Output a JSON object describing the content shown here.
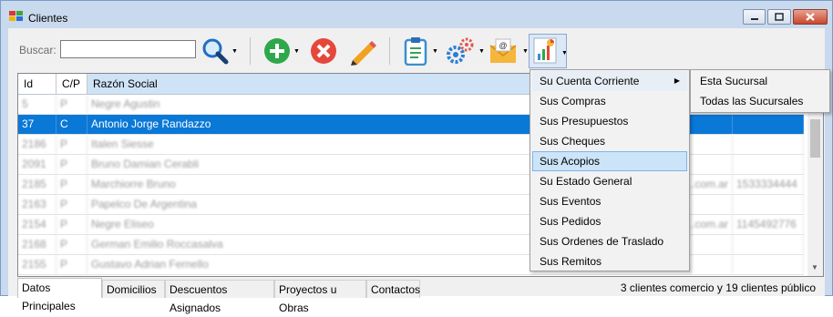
{
  "window": {
    "title": "Clientes"
  },
  "toolbar": {
    "search_label": "Buscar:",
    "search_value": "",
    "buttons": [
      "search-icon",
      "add-icon",
      "delete-icon",
      "edit-icon",
      "clipboard-icon",
      "gear-icon",
      "email-icon",
      "chart-icon"
    ]
  },
  "grid": {
    "headers": [
      "Id",
      "C/P",
      "Razón Social"
    ],
    "rows": [
      {
        "id": "5",
        "cp": "P",
        "rs": "Negre Agustin",
        "ex1": "",
        "ex2": ""
      },
      {
        "id": "37",
        "cp": "C",
        "rs": "Antonio Jorge Randazzo",
        "ex1": "",
        "ex2": ""
      },
      {
        "id": "2186",
        "cp": "P",
        "rs": "Italen Siesse",
        "ex1": "",
        "ex2": ""
      },
      {
        "id": "2091",
        "cp": "P",
        "rs": "Bruno Damian Cerabli",
        "ex1": "",
        "ex2": ""
      },
      {
        "id": "2185",
        "cp": "P",
        "rs": "Marchiorre Bruno",
        "ex1": "...com.ar",
        "ex2": "1533334444"
      },
      {
        "id": "2163",
        "cp": "P",
        "rs": "Papelco De Argentina",
        "ex1": "",
        "ex2": ""
      },
      {
        "id": "2154",
        "cp": "P",
        "rs": "Negre Eliseo",
        "ex1": "...com.ar",
        "ex2": "1145492776"
      },
      {
        "id": "2168",
        "cp": "P",
        "rs": "German Emilio Roccasalva",
        "ex1": "",
        "ex2": ""
      },
      {
        "id": "2155",
        "cp": "P",
        "rs": "Gustavo Adrian Fernello",
        "ex1": "",
        "ex2": ""
      }
    ]
  },
  "menu": {
    "items": [
      "Su Cuenta Corriente",
      "Sus Compras",
      "Sus Presupuestos",
      "Sus Cheques",
      "Sus Acopios",
      "Su Estado General",
      "Sus Eventos",
      "Sus Pedidos",
      "Sus Ordenes de Traslado",
      "Sus Remitos"
    ],
    "highlighted": "Sus Acopios"
  },
  "submenu": {
    "items": [
      "Esta Sucursal",
      "Todas las Sucursales"
    ]
  },
  "tabs": [
    "Datos Principales",
    "Domicilios",
    "Descuentos Asignados",
    "Proyectos u Obras",
    "Contactos"
  ],
  "status": "3 clientes comercio y 19 clientes público",
  "colors": {
    "selection": "#0a78d7",
    "menu_highlight": "#cce4f7",
    "title_bg": "#c9d9ee"
  }
}
